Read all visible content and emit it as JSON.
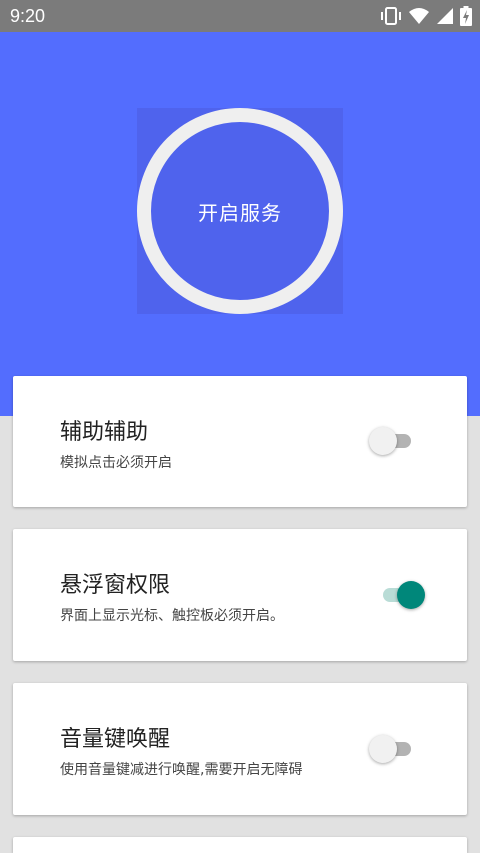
{
  "status_bar": {
    "time": "9:20",
    "icons": [
      "vibrate-icon",
      "wifi-icon",
      "signal-icon",
      "battery-charging-icon"
    ]
  },
  "service": {
    "label": "开启服务"
  },
  "cards": [
    {
      "title": "辅助辅助",
      "description": "模拟点击必须开启",
      "enabled": false
    },
    {
      "title": "悬浮窗权限",
      "description": "界面上显示光标、触控板必须开启。",
      "enabled": true
    },
    {
      "title": "音量键唤醒",
      "description": "使用音量键减进行唤醒,需要开启无障碍",
      "enabled": false
    }
  ],
  "colors": {
    "header": "#536dfe",
    "ring": "#efefef",
    "switch_on": "#00877a",
    "switch_off": "#f1f1f1",
    "status_bar": "#7b7b7b"
  }
}
